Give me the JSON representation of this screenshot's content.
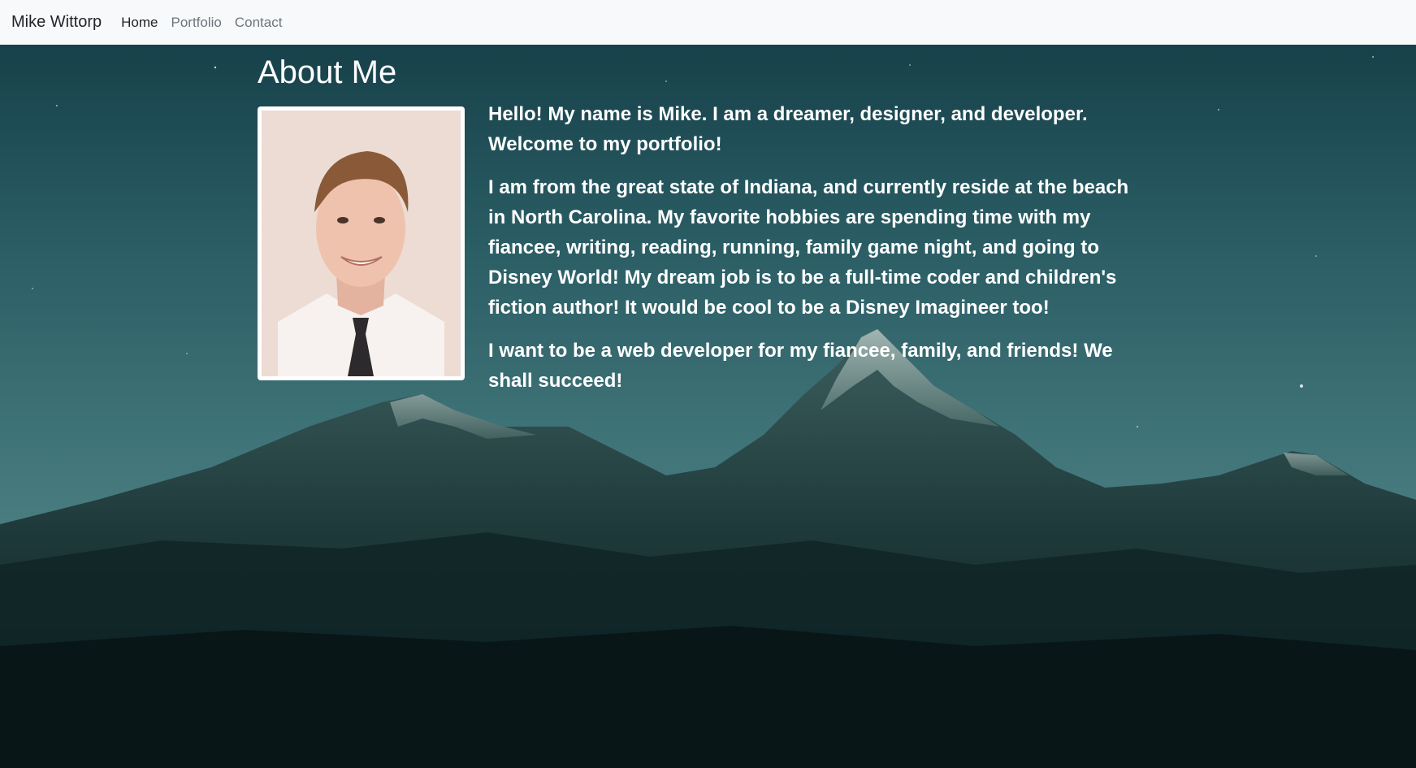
{
  "navbar": {
    "brand": "Mike Wittorp",
    "links": [
      {
        "label": "Home",
        "active": true
      },
      {
        "label": "Portfolio",
        "active": false
      },
      {
        "label": "Contact",
        "active": false
      }
    ]
  },
  "about": {
    "title": "About Me",
    "paragraphs": [
      "Hello! My name is Mike. I am a dreamer, designer, and developer. Welcome to my portfolio!",
      "I am from the great state of Indiana, and currently reside at the beach in North Carolina. My favorite hobbies are spending time with my fiancee, writing, reading, running, family game night, and going to Disney World! My dream job is to be a full-time coder and children's fiction author! It would be cool to be a Disney Imagineer too!",
      "I want to be a web developer for my fiancee, family, and friends! We shall succeed!"
    ]
  },
  "colors": {
    "navbar_bg": "#f8f9fa",
    "nav_active": "#212529",
    "nav_inactive": "#6c757d",
    "text_on_hero": "#ffffff"
  },
  "icons": {
    "profile_photo": "profile-photo"
  }
}
